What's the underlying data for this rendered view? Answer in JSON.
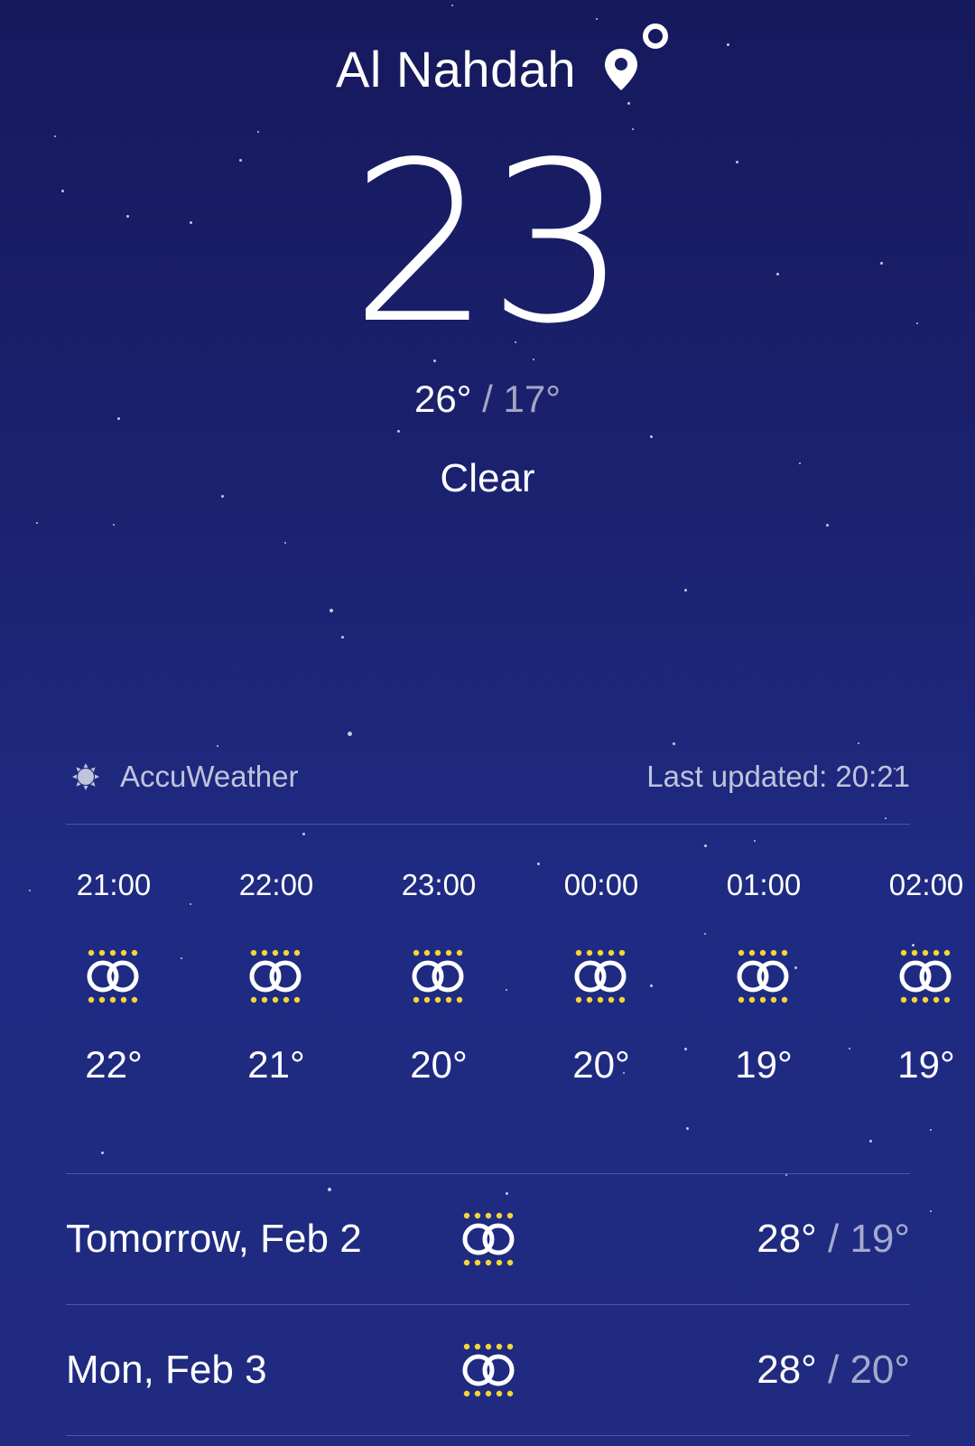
{
  "location": {
    "name": "Al Nahdah",
    "icon": "location-pin-icon"
  },
  "current": {
    "temperature": "23",
    "high": "26°",
    "separator": "/",
    "low": "17°",
    "condition": "Clear"
  },
  "source": {
    "provider": "AccuWeather",
    "provider_icon": "sun-icon",
    "last_updated": "Last updated: 20:21"
  },
  "hourly": [
    {
      "time": "21:00",
      "temp": "22°",
      "icon": "clear-night-icon"
    },
    {
      "time": "22:00",
      "temp": "21°",
      "icon": "clear-night-icon"
    },
    {
      "time": "23:00",
      "temp": "20°",
      "icon": "clear-night-icon"
    },
    {
      "time": "00:00",
      "temp": "20°",
      "icon": "clear-night-icon"
    },
    {
      "time": "01:00",
      "temp": "19°",
      "icon": "clear-night-icon"
    },
    {
      "time": "02:00",
      "temp": "19°",
      "icon": "clear-night-icon"
    }
  ],
  "daily": [
    {
      "label": "Tomorrow, Feb 2",
      "high": "28°",
      "separator": "/",
      "low": "19°",
      "icon": "clear-night-icon"
    },
    {
      "label": "Mon, Feb 3",
      "high": "28°",
      "separator": "/",
      "low": "20°",
      "icon": "clear-night-icon"
    }
  ],
  "colors": {
    "background_top": "#16195c",
    "background_bottom": "#1f2a82",
    "icon_dots": "#f5d53a",
    "text": "#ffffff"
  }
}
